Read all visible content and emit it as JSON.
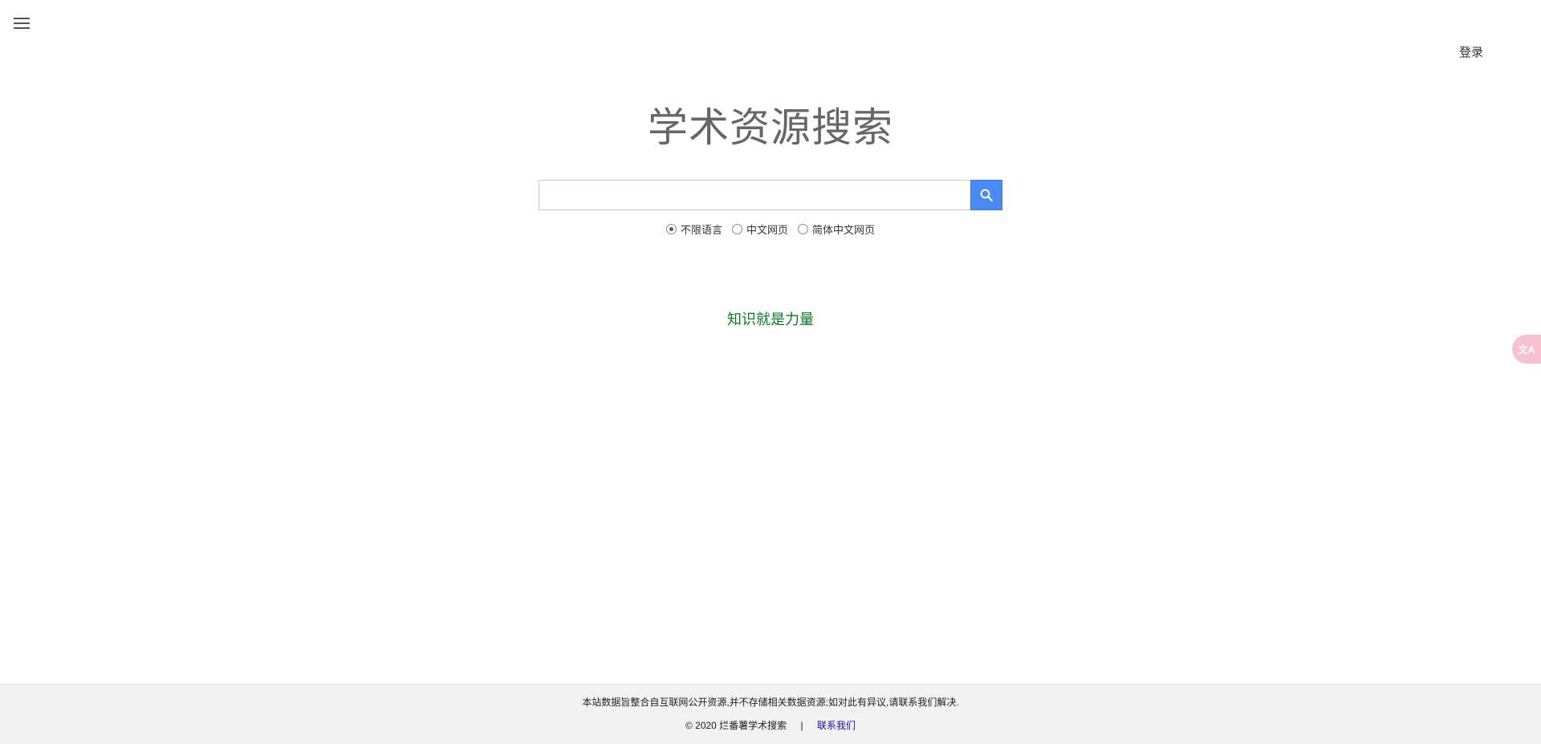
{
  "header": {
    "menu_icon": "hamburger-menu-icon",
    "login_label": "登录"
  },
  "main": {
    "title": "学术资源搜索",
    "search": {
      "placeholder": "",
      "value": "",
      "button_icon": "search-icon",
      "button_color": "#4a8af4"
    },
    "language_options": [
      {
        "label": "不限语言",
        "checked": true
      },
      {
        "label": "中文网页",
        "checked": false
      },
      {
        "label": "简体中文网页",
        "checked": false
      }
    ],
    "slogan": "知识就是力量",
    "slogan_color": "#0a7a1f"
  },
  "side": {
    "translate_icon": "translate-icon",
    "translate_label": "文A"
  },
  "footer": {
    "notice": "本站数据旨整合自互联网公开资源,并不存储相关数据资源;如对此有异议,请联系我们解决.",
    "copyright": "© 2020 烂番薯学术搜索",
    "separator": "|",
    "contact_label": "联系我们"
  }
}
